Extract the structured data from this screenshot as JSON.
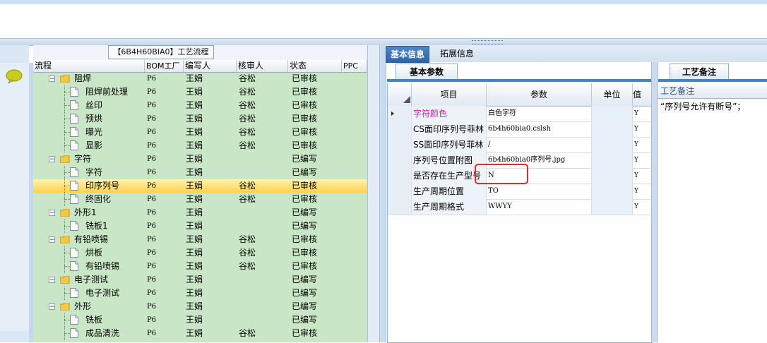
{
  "panel_title": "【6B4H60BIA0】工艺流程",
  "tree_columns": [
    "流程",
    "BOM工厂",
    "编写人",
    "核审人",
    "状态",
    "PPC"
  ],
  "tree_rows": [
    {
      "name": "阻焊",
      "type": "folder",
      "level": 0,
      "factory": "P6",
      "writer": "王娟",
      "reviewer": "谷松",
      "status": "已审核",
      "selected": false
    },
    {
      "name": "阻焊前处理",
      "type": "doc",
      "level": 1,
      "factory": "P6",
      "writer": "王娟",
      "reviewer": "谷松",
      "status": "已审核",
      "selected": false
    },
    {
      "name": "丝印",
      "type": "doc",
      "level": 1,
      "factory": "P6",
      "writer": "王娟",
      "reviewer": "谷松",
      "status": "已审核",
      "selected": false
    },
    {
      "name": "预烘",
      "type": "doc",
      "level": 1,
      "factory": "P6",
      "writer": "王娟",
      "reviewer": "谷松",
      "status": "已审核",
      "selected": false
    },
    {
      "name": "曝光",
      "type": "doc",
      "level": 1,
      "factory": "P6",
      "writer": "王娟",
      "reviewer": "谷松",
      "status": "已审核",
      "selected": false
    },
    {
      "name": "显影",
      "type": "doc",
      "level": 1,
      "factory": "P6",
      "writer": "王娟",
      "reviewer": "谷松",
      "status": "已审核",
      "selected": false
    },
    {
      "name": "字符",
      "type": "folder",
      "level": 0,
      "factory": "P6",
      "writer": "王娟",
      "reviewer": "",
      "status": "已编写",
      "selected": false
    },
    {
      "name": "字符",
      "type": "doc",
      "level": 1,
      "factory": "P6",
      "writer": "王娟",
      "reviewer": "",
      "status": "已编写",
      "selected": false
    },
    {
      "name": "印序列号",
      "type": "doc",
      "level": 1,
      "factory": "P6",
      "writer": "王娟",
      "reviewer": "谷松",
      "status": "已审核",
      "selected": true
    },
    {
      "name": "终固化",
      "type": "doc",
      "level": 1,
      "factory": "P6",
      "writer": "王娟",
      "reviewer": "谷松",
      "status": "已审核",
      "selected": false
    },
    {
      "name": "外形1",
      "type": "folder",
      "level": 0,
      "factory": "P6",
      "writer": "王娟",
      "reviewer": "",
      "status": "已编写",
      "selected": false
    },
    {
      "name": "铣板1",
      "type": "doc",
      "level": 1,
      "factory": "P6",
      "writer": "王娟",
      "reviewer": "",
      "status": "已编写",
      "selected": false
    },
    {
      "name": "有铅喷锡",
      "type": "folder",
      "level": 0,
      "factory": "P6",
      "writer": "王娟",
      "reviewer": "谷松",
      "status": "已审核",
      "selected": false
    },
    {
      "name": "烘板",
      "type": "doc",
      "level": 1,
      "factory": "P6",
      "writer": "王娟",
      "reviewer": "谷松",
      "status": "已审核",
      "selected": false
    },
    {
      "name": "有铅喷锡",
      "type": "doc",
      "level": 1,
      "factory": "P6",
      "writer": "王娟",
      "reviewer": "谷松",
      "status": "已审核",
      "selected": false
    },
    {
      "name": "电子测试",
      "type": "folder",
      "level": 0,
      "factory": "P6",
      "writer": "王娟",
      "reviewer": "",
      "status": "已编写",
      "selected": false
    },
    {
      "name": "电子测试",
      "type": "doc",
      "level": 1,
      "factory": "P6",
      "writer": "王娟",
      "reviewer": "",
      "status": "已编写",
      "selected": false
    },
    {
      "name": "外形",
      "type": "folder",
      "level": 0,
      "factory": "P6",
      "writer": "王娟",
      "reviewer": "",
      "status": "已编写",
      "selected": false
    },
    {
      "name": "铣板",
      "type": "doc",
      "level": 1,
      "factory": "P6",
      "writer": "王娟",
      "reviewer": "",
      "status": "已编写",
      "selected": false
    },
    {
      "name": "成品清洗",
      "type": "doc",
      "level": 1,
      "factory": "P6",
      "writer": "王娟",
      "reviewer": "谷松",
      "status": "已审核",
      "selected": false
    }
  ],
  "tabs": [
    "基本信息",
    "拓展信息"
  ],
  "subtab_params": "基本参数",
  "subtab_notes": "工艺备注",
  "grid_columns": [
    "项目",
    "参数",
    "单位",
    "值"
  ],
  "grid_rows": [
    {
      "item": "字符颜色",
      "param": "白色字符",
      "unit": "",
      "flag": "Y",
      "current": true
    },
    {
      "item": "CS面印序列号菲林",
      "param": "6b4h60bia0.cslsh",
      "unit": "",
      "flag": "Y",
      "current": false
    },
    {
      "item": "SS面印序列号菲林",
      "param": "/",
      "unit": "",
      "flag": "Y",
      "current": false
    },
    {
      "item": "序列号位置附图",
      "param": "6b4h60bia0序列号.jpg",
      "unit": "",
      "flag": "Y",
      "current": false
    },
    {
      "item": "是否存在生产型号",
      "param": "N",
      "unit": "",
      "flag": "Y",
      "current": false
    },
    {
      "item": "生产周期位置",
      "param": "TO",
      "unit": "",
      "flag": "Y",
      "current": false
    },
    {
      "item": "生产周期格式",
      "param": "WWYY",
      "unit": "",
      "flag": "Y",
      "current": false
    }
  ],
  "notes_header": "工艺备注",
  "notes_value": "“序列号允许有断号”；",
  "colors": {
    "tree_bg": "#c9e7c6",
    "selection": "#ffd24d",
    "accent": "#2e63a8",
    "highlight_box": "#d6302a",
    "item_active": "#d11fb0"
  }
}
